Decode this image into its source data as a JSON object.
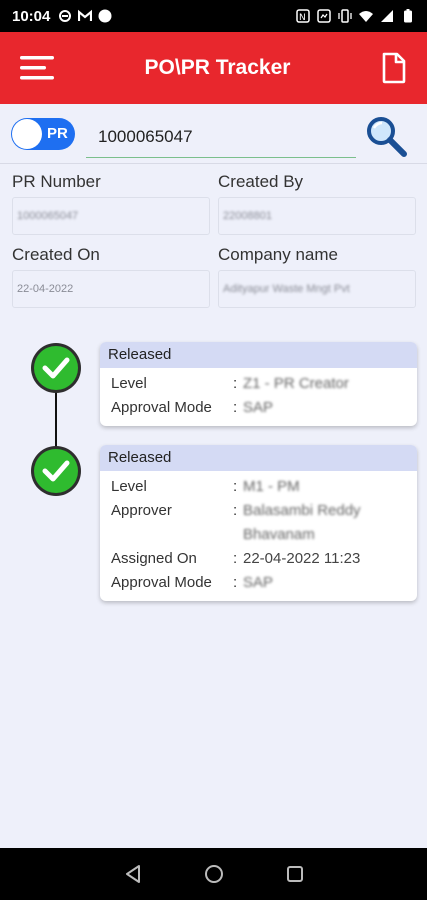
{
  "status_bar": {
    "time": "10:04"
  },
  "app_bar": {
    "title": "PO\\PR Tracker"
  },
  "search": {
    "toggle_label": "PR",
    "po_number": "1000065047"
  },
  "fields": {
    "pr_number": {
      "label": "PR Number",
      "value": "1000065047"
    },
    "created_by": {
      "label": "Created By",
      "value": "22008801"
    },
    "created_on": {
      "label": "Created On",
      "value": "22-04-2022"
    },
    "company_name": {
      "label": "Company name",
      "value": "Adityapur Waste Mngt Pvt"
    }
  },
  "timeline": [
    {
      "status": "Released",
      "rows": [
        {
          "key": "Level",
          "sep": ":",
          "value": "Z1 - PR Creator"
        },
        {
          "key": "Approval Mode",
          "sep": ":",
          "value": "SAP"
        }
      ]
    },
    {
      "status": "Released",
      "rows": [
        {
          "key": "Level",
          "sep": ":",
          "value": "M1 - PM"
        },
        {
          "key": "Approver",
          "sep": ":",
          "value": "Balasambi Reddy Bhavanam"
        },
        {
          "key": "Assigned On",
          "sep": ":",
          "value": "22-04-2022 11:23"
        },
        {
          "key": "Approval Mode",
          "sep": ":",
          "value": "SAP"
        }
      ]
    }
  ],
  "colors": {
    "app_bar": "#e8272d",
    "toggle": "#1e6ff1",
    "check": "#2fbb2f",
    "card_header": "#d4daf4"
  },
  "icons": [
    "menu-icon",
    "document-icon",
    "search-icon",
    "check-icon",
    "back-icon",
    "home-icon",
    "recents-icon"
  ]
}
